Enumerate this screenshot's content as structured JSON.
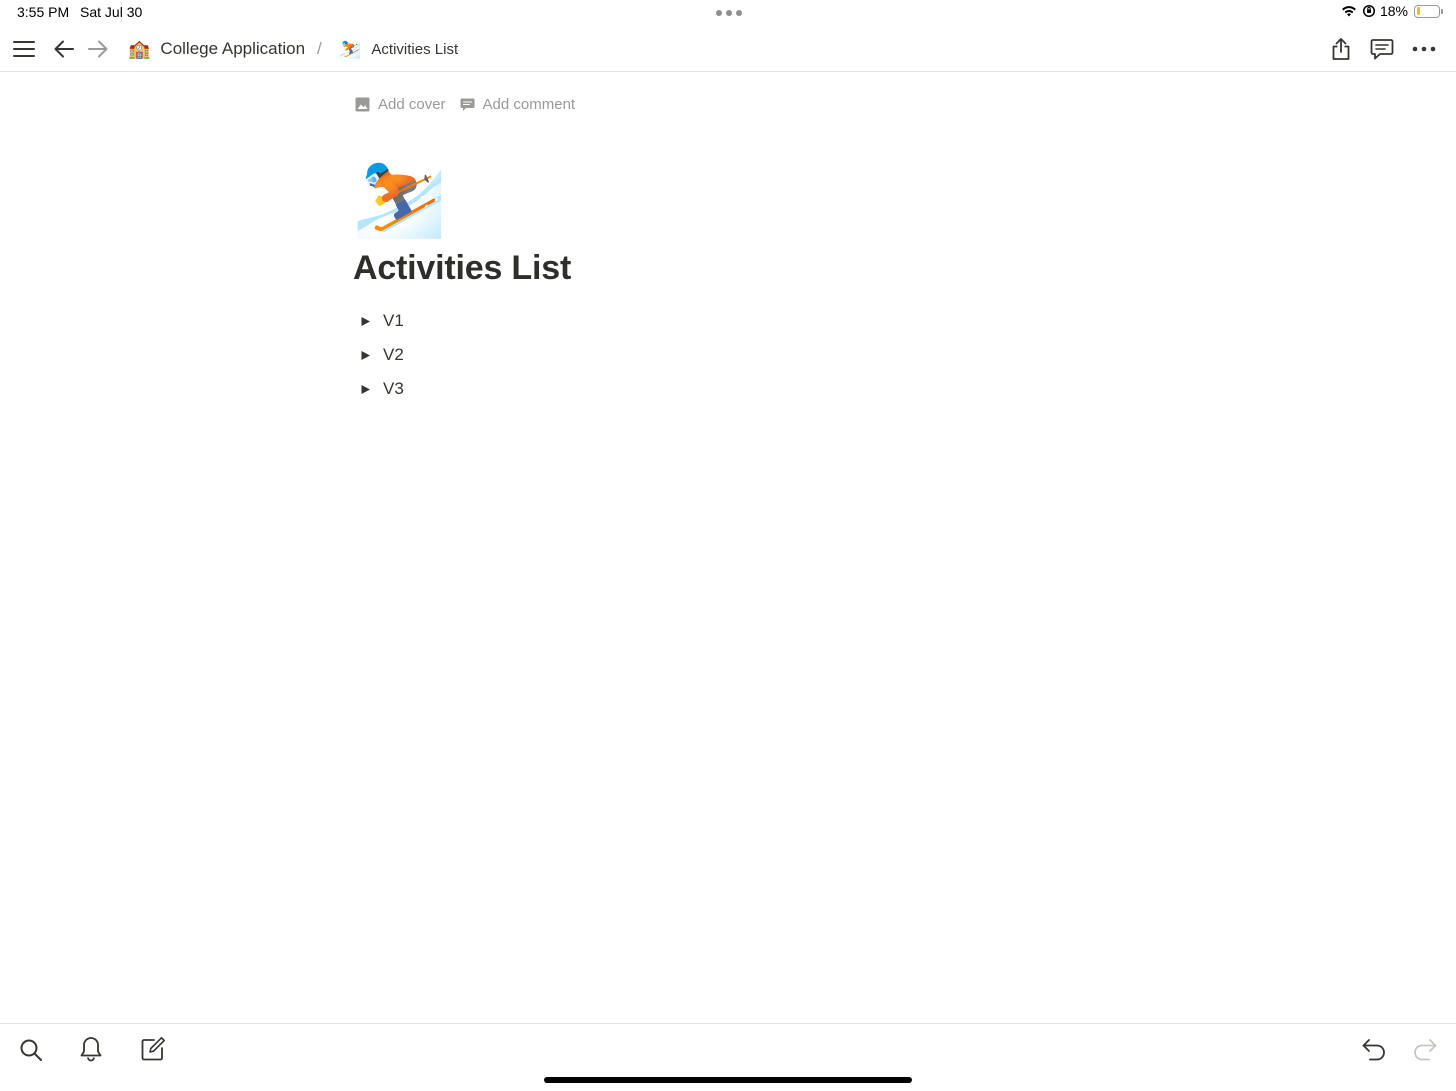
{
  "status_bar": {
    "time": "3:55 PM",
    "date": "Sat Jul 30",
    "battery_percent": "18%",
    "battery_level": 0.18
  },
  "topbar": {
    "breadcrumb": [
      {
        "emoji": "🏫",
        "label": "College Application"
      },
      {
        "emoji": "⛷️",
        "label": "Activities List"
      }
    ],
    "separator": "/"
  },
  "page": {
    "actions": {
      "add_cover": "Add cover",
      "add_comment": "Add comment"
    },
    "icon_emoji": "⛷️",
    "title": "Activities List",
    "toggles": [
      {
        "label": "V1"
      },
      {
        "label": "V2"
      },
      {
        "label": "V3"
      }
    ]
  },
  "colors": {
    "text": "#37352f",
    "muted": "#9b9a97",
    "divider": "#e3e3e1",
    "battery": "#f2c200"
  }
}
